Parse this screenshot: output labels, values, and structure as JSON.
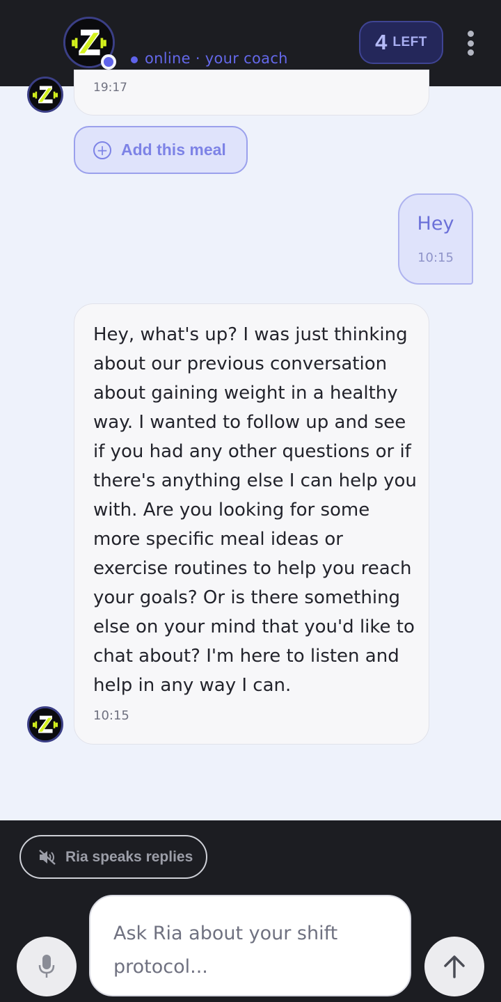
{
  "header": {
    "status_text": "online · your coach",
    "credits": {
      "count": "4",
      "label": "LEFT"
    }
  },
  "chat": {
    "previous_message_time": "19:17",
    "add_meal_label": "Add this meal",
    "user_message": {
      "text": "Hey",
      "time": "10:15"
    },
    "bot_message": {
      "text": "Hey, what's up? I was just thinking about our previous conversation about gaining weight in a healthy way. I wanted to follow up and see if you had any other questions or if there's anything else I can help you with. Are you looking for some more specific meal ideas or exercise routines to help you reach your goals? Or is there something else on your mind that you'd like to chat about? I'm here to listen and help in any way I can.",
      "time": "10:15"
    }
  },
  "composer": {
    "voice_toggle_label": "Ria speaks replies",
    "input_placeholder": "Ask Ria about your shift protocol..."
  },
  "icons": {
    "avatar": "z-logo-icon",
    "voice_toggle": "speaker-muted-icon",
    "mic": "microphone-icon",
    "send": "arrow-up-icon",
    "menu": "kebab-menu-icon",
    "add": "plus-circle-icon"
  },
  "colors": {
    "accent": "#5f63ea",
    "header_bg": "#1c1d22",
    "chat_bg": "#eef2fb",
    "logo_yellow": "#d4f11d"
  }
}
